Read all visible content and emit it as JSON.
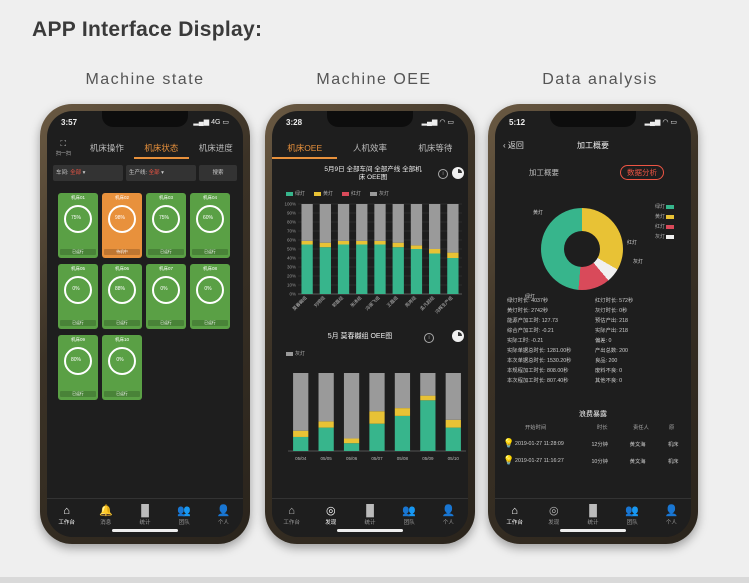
{
  "heading": "APP Interface Display:",
  "captions": [
    "Machine state",
    "Machine OEE",
    "Data analysis"
  ],
  "colors": {
    "green": "#37b58c",
    "yellow": "#e8c235",
    "red": "#d94a5a",
    "gray": "#9a9a9a",
    "orange": "#e8913c",
    "card_green": "#5aa045"
  },
  "phone1": {
    "time": "3:57",
    "signal": "4G",
    "scan_label": "扫一扫",
    "tabs": [
      "机床操作",
      "机床状态",
      "机床进度"
    ],
    "active_tab": 1,
    "filters": [
      {
        "label": "车间:",
        "value": "全部"
      },
      {
        "label": "生产线:",
        "value": "全部"
      },
      {
        "label": "搜索",
        "value": ""
      }
    ],
    "cards": [
      {
        "name": "机床01",
        "color": "green",
        "value": "75%",
        "status": "已运行"
      },
      {
        "name": "机床02",
        "color": "orange",
        "value": "98%",
        "status": "待机中"
      },
      {
        "name": "机床03",
        "color": "green",
        "value": "75%",
        "status": "已运行"
      },
      {
        "name": "机床04",
        "color": "green",
        "value": "60%",
        "status": "已运行"
      },
      {
        "name": "机床05",
        "color": "green",
        "value": "0%",
        "status": "已运行"
      },
      {
        "name": "机床06",
        "color": "green",
        "value": "88%",
        "status": "已运行"
      },
      {
        "name": "机床07",
        "color": "green",
        "value": "0%",
        "status": "已运行"
      },
      {
        "name": "机床08",
        "color": "green",
        "value": "0%",
        "status": "已运行"
      },
      {
        "name": "机床09",
        "color": "green",
        "value": "80%",
        "status": "已运行"
      },
      {
        "name": "机床10",
        "color": "green",
        "value": "0%",
        "status": "已运行"
      }
    ],
    "nav": [
      {
        "label": "工作台",
        "icon": "home"
      },
      {
        "label": "消息",
        "icon": "bell"
      },
      {
        "label": "统计",
        "icon": "chart"
      },
      {
        "label": "团队",
        "icon": "team"
      },
      {
        "label": "个人",
        "icon": "person"
      }
    ]
  },
  "phone2": {
    "time": "3:28",
    "tabs": [
      "机床OEE",
      "人机效率",
      "机床等待"
    ],
    "active_tab": 0,
    "chart1_title": "5月9日 全部车间 全部产线 全部机床 OEE图",
    "legend1": [
      "绿灯",
      "黄灯",
      "红灯",
      "灰灯"
    ],
    "chart2_title": "5月 莫春樾组 OEE图",
    "legend2": [
      "灰灯"
    ],
    "nav": [
      {
        "label": "工作台",
        "icon": "home"
      },
      {
        "label": "发现",
        "icon": "compass"
      },
      {
        "label": "统计",
        "icon": "chart"
      },
      {
        "label": "团队",
        "icon": "team"
      },
      {
        "label": "个人",
        "icon": "person"
      }
    ]
  },
  "phone3": {
    "time": "5:12",
    "back_label": "返回",
    "title": "加工概要",
    "subtabs": [
      "加工概要",
      "数据分析"
    ],
    "active_subtab": 1,
    "pie_labels": [
      "绿灯",
      "黄灯",
      "红灯",
      "灰灯"
    ],
    "stats": [
      "绿灯时长: 4037秒",
      "红灯时长: 572秒",
      "黄灯时长: 2742秒",
      "灰灯时长: 0秒",
      "能源产加工时: 127.73",
      "预估产出: 218",
      "综合产加工时: -0.21",
      "实际产出: 218",
      "实际工时: -0.21",
      "偏差: 0",
      "实际单据总时长: 1281.00秒",
      "产出总数: 200",
      "本次单据总时长: 1530.20秒",
      "良品: 200",
      "本规程加工时长: 808.00秒",
      "废料不良: 0",
      "本次程加工时长: 807.40秒",
      "其他不良: 0"
    ],
    "section_title": "浪费暴露",
    "table_headers": [
      "开始时间",
      "时长",
      "责任人",
      "原"
    ],
    "rows": [
      {
        "start": "2019-01-27 11:28:09",
        "duration": "12分钟",
        "person": "黄文海",
        "reason": "机床"
      },
      {
        "start": "2019-01-27 11:16:27",
        "duration": "10分钟",
        "person": "黄文海",
        "reason": "机床"
      }
    ],
    "nav": [
      {
        "label": "工作台",
        "icon": "home"
      },
      {
        "label": "发现",
        "icon": "compass"
      },
      {
        "label": "统计",
        "icon": "chart"
      },
      {
        "label": "团队",
        "icon": "team"
      },
      {
        "label": "个人",
        "icon": "person"
      }
    ]
  },
  "chart_data": [
    {
      "type": "bar",
      "title": "5月9日 全部车间 全部产线 全部机床 OEE图",
      "xlabel": "",
      "ylabel": "",
      "ylim": [
        0,
        100
      ],
      "yticks": [
        "0%",
        "10%",
        "20%",
        "30%",
        "40%",
        "50%",
        "60%",
        "70%",
        "80%",
        "90%",
        "100%"
      ],
      "categories": [
        "莫春樾组",
        "刘明组",
        "郭磊组",
        "张涛组",
        "冯振飞组",
        "王磊组",
        "周亮组",
        "孟凡超组",
        "冯辉生产组"
      ],
      "stacked": true,
      "series": [
        {
          "name": "绿灯",
          "values": [
            55,
            52,
            55,
            55,
            55,
            52,
            50,
            45,
            40
          ]
        },
        {
          "name": "黄灯",
          "values": [
            4,
            5,
            4,
            4,
            4,
            5,
            4,
            5,
            6
          ]
        },
        {
          "name": "红灯",
          "values": [
            0,
            0,
            0,
            0,
            0,
            0,
            0,
            0,
            0
          ]
        },
        {
          "name": "灰灯",
          "values": [
            41,
            43,
            41,
            41,
            41,
            43,
            46,
            50,
            54
          ]
        }
      ]
    },
    {
      "type": "bar",
      "title": "5月 莫春樾组 OEE图",
      "xlabel": "",
      "ylabel": "",
      "ylim": [
        0,
        100
      ],
      "categories": [
        "05/04",
        "05/05",
        "05/06",
        "05/07",
        "05/08",
        "05/09",
        "05/10"
      ],
      "stacked": true,
      "series": [
        {
          "name": "绿灯",
          "values": [
            18,
            30,
            10,
            35,
            45,
            65,
            30
          ]
        },
        {
          "name": "黄灯",
          "values": [
            8,
            8,
            6,
            16,
            10,
            6,
            10
          ]
        },
        {
          "name": "灰灯",
          "values": [
            74,
            62,
            84,
            49,
            45,
            29,
            60
          ]
        }
      ]
    }
  ]
}
